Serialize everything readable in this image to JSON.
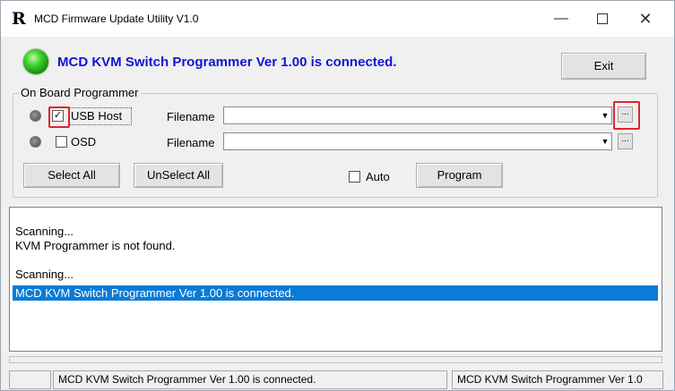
{
  "window": {
    "title": "MCD Firmware Update Utility V1.0",
    "app_icon_glyph": "R",
    "minimize_glyph": "—",
    "close_glyph": "✕"
  },
  "header": {
    "status_message": "MCD KVM Switch Programmer Ver 1.00 is connected.",
    "status_color": "#1014d8",
    "led_color": "#3fd12b",
    "exit_label": "Exit"
  },
  "programmer": {
    "group_label": "On Board Programmer",
    "rows": [
      {
        "checkbox_label": "USB Host",
        "checked": true,
        "checkbox_glyph": "✓",
        "filename_label": "Filename",
        "filename_value": "",
        "browse_label": "..."
      },
      {
        "checkbox_label": "OSD",
        "checked": false,
        "checkbox_glyph": "",
        "filename_label": "Filename",
        "filename_value": "",
        "browse_label": "..."
      }
    ],
    "select_all_label": "Select All",
    "unselect_all_label": "UnSelect All",
    "auto_label": "Auto",
    "auto_checked": false,
    "program_label": "Program",
    "highlight_color": "#e0252e"
  },
  "log": {
    "lines": [
      "Scanning...",
      "KVM Programmer is not found.",
      "",
      "Scanning...",
      "MCD KVM Switch Programmer Ver 1.00 is connected."
    ],
    "selected_index": 4,
    "selection_color": "#0a7bd6"
  },
  "statusbar": {
    "pane1": "",
    "pane2": "MCD KVM Switch Programmer Ver 1.00 is connected.",
    "pane3": "MCD KVM Switch Programmer Ver 1.0"
  }
}
